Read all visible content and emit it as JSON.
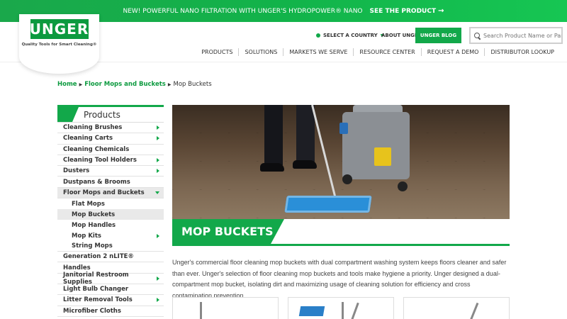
{
  "promo": {
    "text": "NEW! POWERFUL NANO FILTRATION WITH UNGER'S HYDROPOWER® NANO",
    "cta": "SEE THE PRODUCT",
    "arrow_icon": "arrow-right-icon"
  },
  "logo": {
    "text": "UNGER",
    "tagline": "Quality Tools for Smart Cleaning®"
  },
  "utility": {
    "country": "SELECT A COUNTRY",
    "about": "ABOUT UNGER",
    "blog": "UNGER BLOG"
  },
  "search": {
    "placeholder": "Search Product Name or Part #"
  },
  "mainnav": {
    "items": [
      "PRODUCTS",
      "SOLUTIONS",
      "MARKETS WE SERVE",
      "RESOURCE CENTER",
      "REQUEST A DEMO",
      "DISTRIBUTOR LOOKUP"
    ]
  },
  "breadcrumb": {
    "home": "Home",
    "parent": "Floor Mops and Buckets",
    "current": "Mop Buckets"
  },
  "sidebar": {
    "title": "Products",
    "items": [
      {
        "label": "Cleaning Brushes",
        "arrow": true
      },
      {
        "label": "Cleaning Carts",
        "arrow": true
      },
      {
        "label": "Cleaning Chemicals",
        "arrow": false
      },
      {
        "label": "Cleaning Tool Holders",
        "arrow": true
      },
      {
        "label": "Dusters",
        "arrow": true
      },
      {
        "label": "Dustpans & Brooms",
        "arrow": false
      },
      {
        "label": "Floor Mops and Buckets",
        "arrow": true,
        "open": true
      }
    ],
    "subitems": [
      {
        "label": "Flat Mops",
        "arrow": false
      },
      {
        "label": "Mop Buckets",
        "arrow": false,
        "active": true
      },
      {
        "label": "Mop Handles",
        "arrow": false
      },
      {
        "label": "Mop Kits",
        "arrow": true
      },
      {
        "label": "String Mops",
        "arrow": false
      }
    ],
    "items_after": [
      {
        "label": "Generation 2 nLITE®",
        "arrow": false
      },
      {
        "label": "Handles",
        "arrow": false
      },
      {
        "label": "Janitorial Restroom Supplies",
        "arrow": true
      },
      {
        "label": "Light Bulb Changer",
        "arrow": false
      },
      {
        "label": "Litter Removal Tools",
        "arrow": true
      },
      {
        "label": "Microfiber Cloths",
        "arrow": false
      }
    ]
  },
  "page": {
    "title": "MOP BUCKETS",
    "description": "Unger's commercial floor cleaning mop buckets with dual compartment washing system keeps floors cleaner and safer than ever. Unger's selection of floor cleaning mop buckets and tools make hygiene a priority.  Unger designed a dual-compartment mop bucket, isolating dirt and maximizing usage of cleaning solution for efficiency and cross contamination prevention."
  },
  "colors": {
    "brand_green": "#12a84a",
    "text": "#333333"
  }
}
